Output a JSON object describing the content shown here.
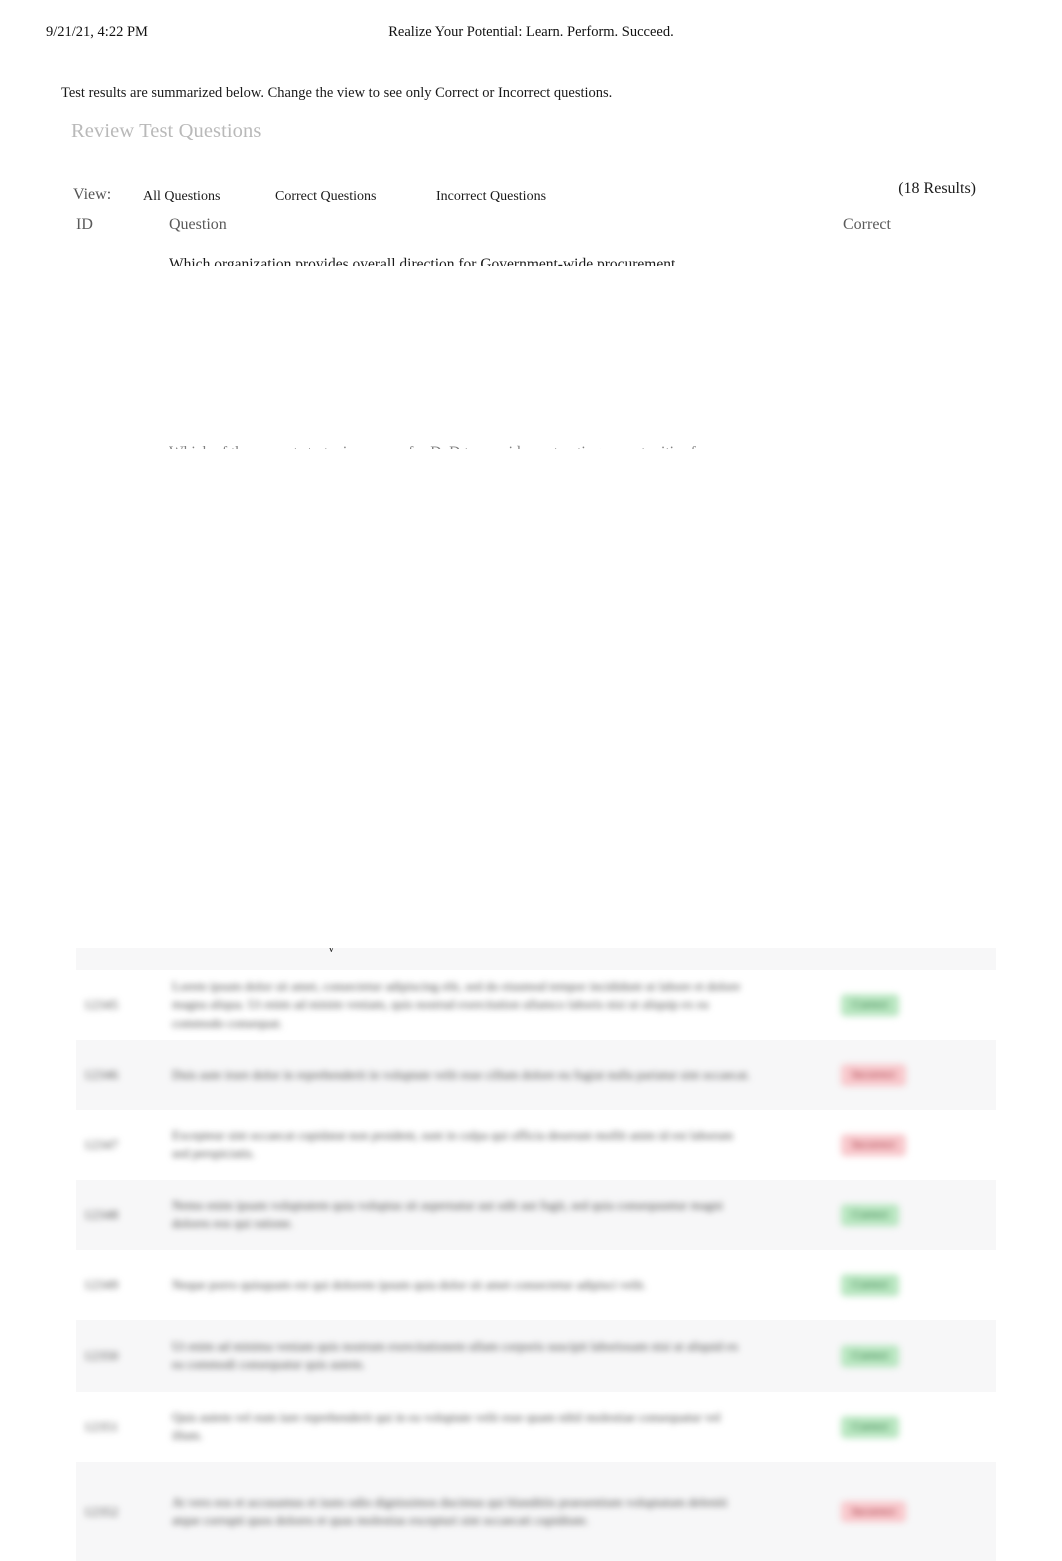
{
  "print_header": {
    "date": "9/21/21, 4:22 PM",
    "tagline": "Realize Your Potential: Learn. Perform. Succeed."
  },
  "intro": {
    "text": "Test results are summarized below. Change the view to see only Correct or Incorrect questions."
  },
  "page_title": "Review Test Questions",
  "view": {
    "label": "View:",
    "tabs": [
      {
        "label": "All Questions"
      },
      {
        "label": "Correct Questions"
      },
      {
        "label": "Incorrect Questions"
      }
    ],
    "results_count": "(18 Results)"
  },
  "table": {
    "columns": {
      "id": "ID",
      "question": "Question",
      "correct": "Correct"
    },
    "top_fragment": "y",
    "clipped_questions": [
      "Which organization provides overall direction for Government-wide procurement",
      "Which of the current strategic sources for DoD to provide contracting opportunities for"
    ],
    "rows": [
      {
        "id": "12345",
        "question": "Lorem ipsum dolor sit amet, consectetur adipiscing elit, sed do eiusmod tempor incididunt ut labore et dolore magna aliqua. Ut enim ad minim veniam, quis nostrud exercitation ullamco laboris nisi ut aliquip ex ea commodo consequat.",
        "correct": "Correct",
        "state": "yes"
      },
      {
        "id": "12346",
        "question": "Duis aute irure dolor in reprehenderit in voluptate velit esse cillum dolore eu fugiat nulla pariatur sint occaecat.",
        "correct": "Incorrect",
        "state": "no"
      },
      {
        "id": "12347",
        "question": "Excepteur sint occaecat cupidatat non proident, sunt in culpa qui officia deserunt mollit anim id est laborum sed perspiciatis.",
        "correct": "Incorrect",
        "state": "no"
      },
      {
        "id": "12348",
        "question": "Nemo enim ipsam voluptatem quia voluptas sit aspernatur aut odit aut fugit, sed quia consequuntur magni dolores eos qui ratione.",
        "correct": "Correct",
        "state": "yes"
      },
      {
        "id": "12349",
        "question": "Neque porro quisquam est qui dolorem ipsum quia dolor sit amet consectetur adipisci velit.",
        "correct": "Correct",
        "state": "yes"
      },
      {
        "id": "12350",
        "question": "Ut enim ad minima veniam quis nostrum exercitationem ullam corporis suscipit laboriosam nisi ut aliquid ex ea commodi consequatur quis autem.",
        "correct": "Correct",
        "state": "yes"
      },
      {
        "id": "12351",
        "question": "Quis autem vel eum iure reprehenderit qui in ea voluptate velit esse quam nihil molestiae consequatur vel illum.",
        "correct": "Correct",
        "state": "yes"
      },
      {
        "id": "12352",
        "question": "At vero eos et accusamus et iusto odio dignissimos ducimus qui blanditiis praesentium voluptatum deleniti atque corrupti quos dolores et quas molestias excepturi sint occaecati cupiditate.",
        "correct": "Incorrect",
        "state": "no"
      }
    ]
  },
  "colors": {
    "badge_correct_bg": "#b8e6c0",
    "badge_correct_text": "#1d6b33",
    "badge_incorrect_bg": "#f8c8cc",
    "badge_incorrect_text": "#9c2430",
    "row_stripe": "#f7f7f8",
    "title_gray": "#b9b9b9",
    "page_bg": "#ffffff"
  }
}
